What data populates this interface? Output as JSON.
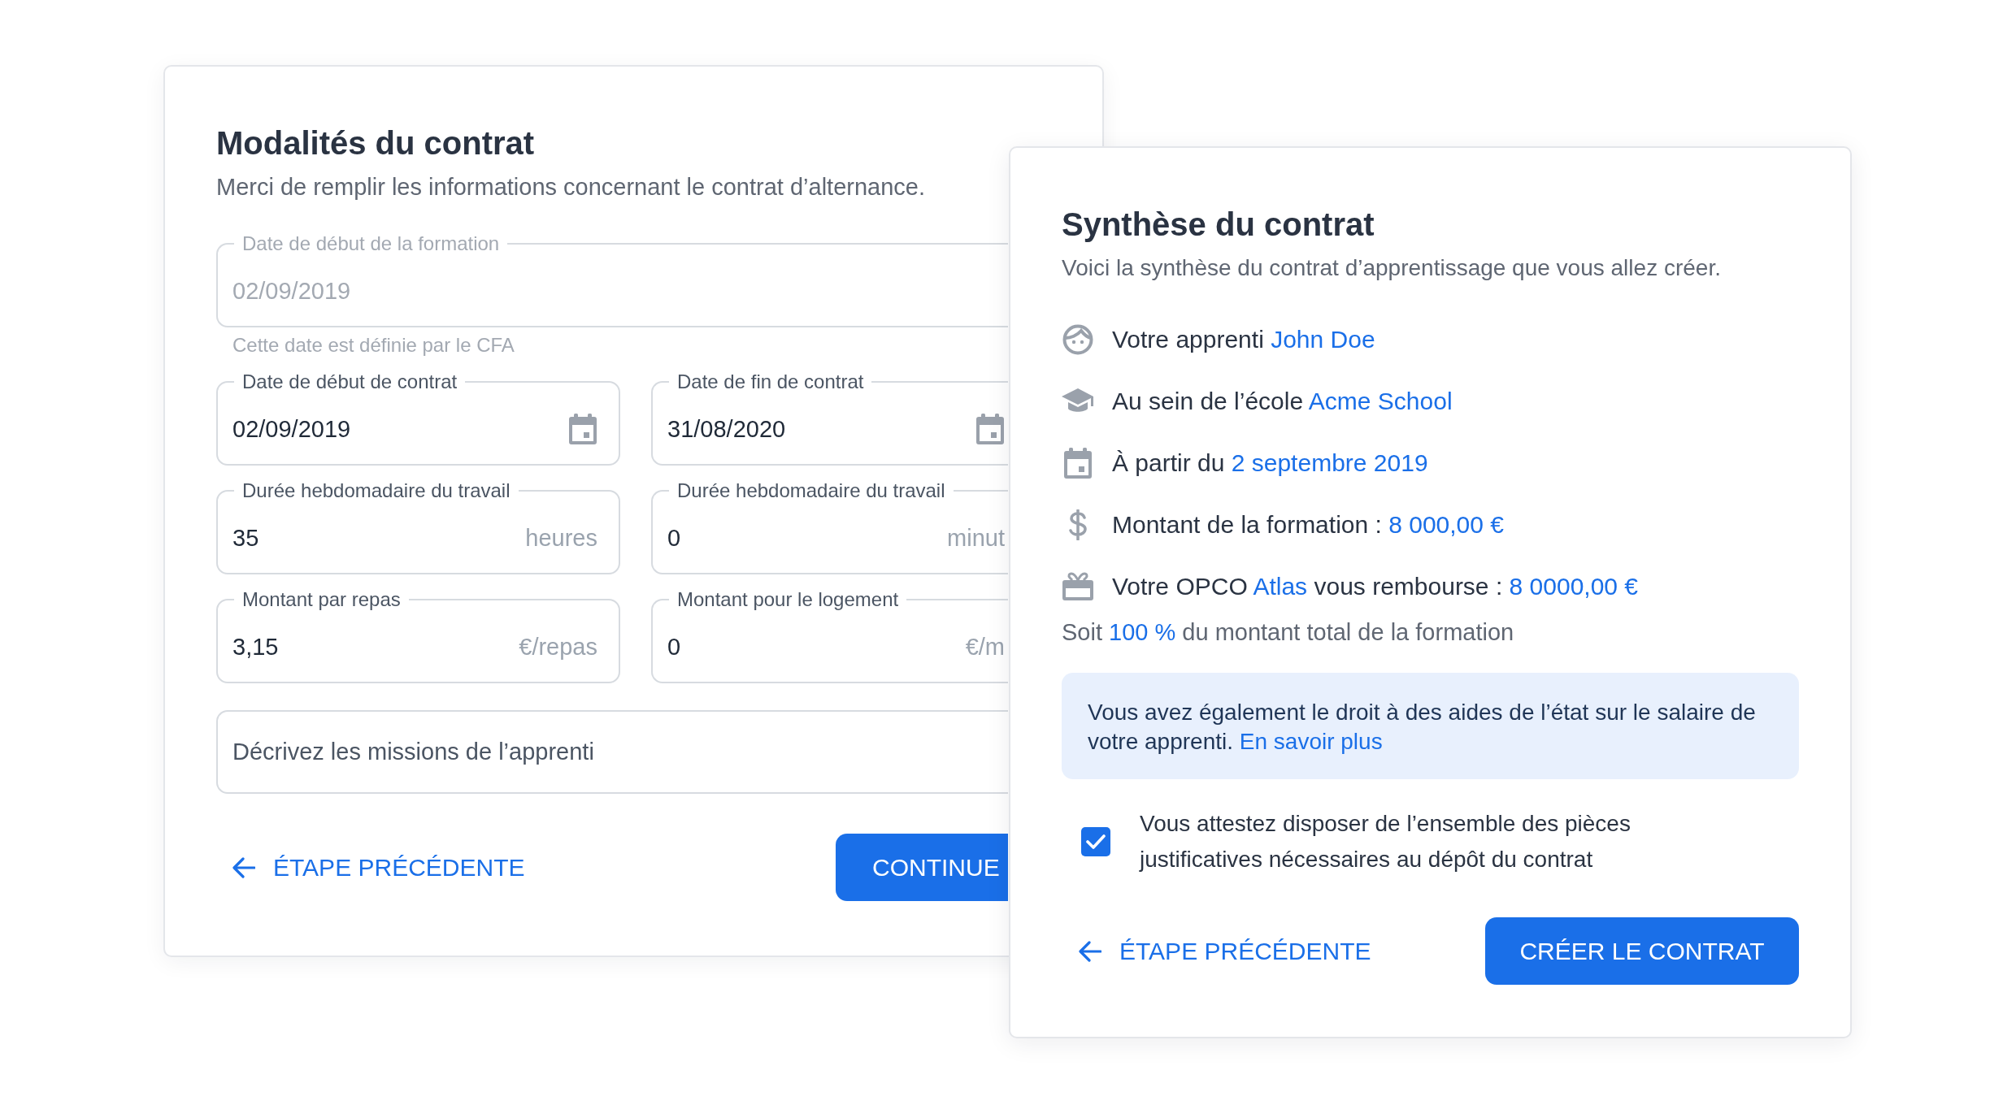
{
  "contract_form": {
    "title": "Modalités du contrat",
    "subtitle": "Merci de remplir les informations concernant le contrat d’alternance.",
    "training_start": {
      "label": "Date de début de la formation",
      "value": "02/09/2019",
      "disabled": true,
      "helper": "Cette date est définie par le CFA"
    },
    "field_rows": [
      [
        {
          "kind": "date",
          "label": "Date de début de contrat",
          "value": "02/09/2019",
          "disabled": false
        },
        {
          "kind": "date",
          "label": "Date de fin de contrat",
          "value": "31/08/2020",
          "disabled": false
        }
      ],
      [
        {
          "kind": "unit",
          "label": "Durée hebdomadaire du travail",
          "value": "35",
          "unit": "heures",
          "disabled": false
        },
        {
          "kind": "unit",
          "label": "Durée hebdomadaire du travail",
          "value": "0",
          "unit": "minut",
          "disabled": false
        }
      ],
      [
        {
          "kind": "unit",
          "label": "Montant par repas",
          "value": "3,15",
          "unit": "€/repas",
          "disabled": false
        },
        {
          "kind": "unit",
          "label": "Montant pour le logement",
          "value": "0",
          "unit": "€/m",
          "disabled": false
        }
      ]
    ],
    "missions_field": {
      "placeholder": "Décrivez les missions de l’apprenti"
    },
    "back_link": "ÉTAPE PRÉCÉDENTE",
    "continue_button": "CONTINUE"
  },
  "summary": {
    "title": "Synthèse du contrat",
    "subtitle": "Voici la synthèse du contrat d’apprentissage que vous allez créer.",
    "items": [
      {
        "kind": "person",
        "segments": [
          {
            "text": "Votre apprenti ",
            "highlight": false
          },
          {
            "text": "John Doe",
            "highlight": true
          }
        ]
      },
      {
        "kind": "school",
        "segments": [
          {
            "text": "Au sein de l’école ",
            "highlight": false
          },
          {
            "text": "Acme School",
            "highlight": true
          }
        ]
      },
      {
        "kind": "calendar",
        "segments": [
          {
            "text": "À partir du ",
            "highlight": false
          },
          {
            "text": "2 septembre 2019",
            "highlight": true
          }
        ]
      },
      {
        "kind": "money",
        "segments": [
          {
            "text": "Montant de la formation : ",
            "highlight": false
          },
          {
            "text": "8 000,00 €",
            "highlight": true
          }
        ]
      },
      {
        "kind": "gift",
        "segments": [
          {
            "text": "Votre OPCO ",
            "highlight": false
          },
          {
            "text": "Atlas",
            "highlight": true
          },
          {
            "text": " vous rembourse : ",
            "highlight": false
          },
          {
            "text": "8 0000,00 €",
            "highlight": true
          }
        ]
      }
    ],
    "share": {
      "segments": [
        {
          "text": "Soit ",
          "highlight": false
        },
        {
          "text": "100 %",
          "highlight": true
        },
        {
          "text": " du montant total de la formation",
          "highlight": false
        }
      ]
    },
    "info": {
      "text": "Vous avez également le droit à des aides de l’état sur le salaire de votre apprenti.",
      "link": "En savoir plus"
    },
    "attestation": {
      "checked": true,
      "label": "Vous attestez disposer de l’ensemble des pièces justificatives nécessaires au dépôt du contrat"
    },
    "back_link": "ÉTAPE PRÉCÉDENTE",
    "create_button": "CRÉER LE CONTRAT"
  }
}
